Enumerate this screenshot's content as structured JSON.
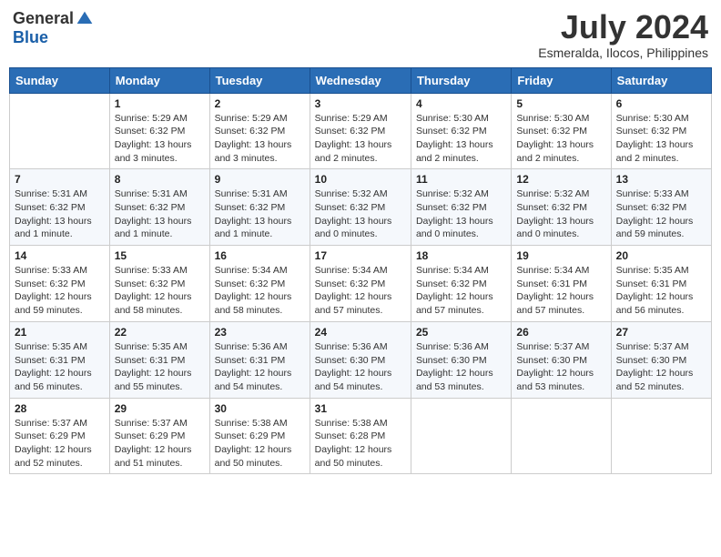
{
  "header": {
    "logo_general": "General",
    "logo_blue": "Blue",
    "month_year": "July 2024",
    "location": "Esmeralda, Ilocos, Philippines"
  },
  "weekdays": [
    "Sunday",
    "Monday",
    "Tuesday",
    "Wednesday",
    "Thursday",
    "Friday",
    "Saturday"
  ],
  "weeks": [
    [
      {
        "day": "",
        "sunrise": "",
        "sunset": "",
        "daylight": ""
      },
      {
        "day": "1",
        "sunrise": "Sunrise: 5:29 AM",
        "sunset": "Sunset: 6:32 PM",
        "daylight": "Daylight: 13 hours and 3 minutes."
      },
      {
        "day": "2",
        "sunrise": "Sunrise: 5:29 AM",
        "sunset": "Sunset: 6:32 PM",
        "daylight": "Daylight: 13 hours and 3 minutes."
      },
      {
        "day": "3",
        "sunrise": "Sunrise: 5:29 AM",
        "sunset": "Sunset: 6:32 PM",
        "daylight": "Daylight: 13 hours and 2 minutes."
      },
      {
        "day": "4",
        "sunrise": "Sunrise: 5:30 AM",
        "sunset": "Sunset: 6:32 PM",
        "daylight": "Daylight: 13 hours and 2 minutes."
      },
      {
        "day": "5",
        "sunrise": "Sunrise: 5:30 AM",
        "sunset": "Sunset: 6:32 PM",
        "daylight": "Daylight: 13 hours and 2 minutes."
      },
      {
        "day": "6",
        "sunrise": "Sunrise: 5:30 AM",
        "sunset": "Sunset: 6:32 PM",
        "daylight": "Daylight: 13 hours and 2 minutes."
      }
    ],
    [
      {
        "day": "7",
        "sunrise": "Sunrise: 5:31 AM",
        "sunset": "Sunset: 6:32 PM",
        "daylight": "Daylight: 13 hours and 1 minute."
      },
      {
        "day": "8",
        "sunrise": "Sunrise: 5:31 AM",
        "sunset": "Sunset: 6:32 PM",
        "daylight": "Daylight: 13 hours and 1 minute."
      },
      {
        "day": "9",
        "sunrise": "Sunrise: 5:31 AM",
        "sunset": "Sunset: 6:32 PM",
        "daylight": "Daylight: 13 hours and 1 minute."
      },
      {
        "day": "10",
        "sunrise": "Sunrise: 5:32 AM",
        "sunset": "Sunset: 6:32 PM",
        "daylight": "Daylight: 13 hours and 0 minutes."
      },
      {
        "day": "11",
        "sunrise": "Sunrise: 5:32 AM",
        "sunset": "Sunset: 6:32 PM",
        "daylight": "Daylight: 13 hours and 0 minutes."
      },
      {
        "day": "12",
        "sunrise": "Sunrise: 5:32 AM",
        "sunset": "Sunset: 6:32 PM",
        "daylight": "Daylight: 13 hours and 0 minutes."
      },
      {
        "day": "13",
        "sunrise": "Sunrise: 5:33 AM",
        "sunset": "Sunset: 6:32 PM",
        "daylight": "Daylight: 12 hours and 59 minutes."
      }
    ],
    [
      {
        "day": "14",
        "sunrise": "Sunrise: 5:33 AM",
        "sunset": "Sunset: 6:32 PM",
        "daylight": "Daylight: 12 hours and 59 minutes."
      },
      {
        "day": "15",
        "sunrise": "Sunrise: 5:33 AM",
        "sunset": "Sunset: 6:32 PM",
        "daylight": "Daylight: 12 hours and 58 minutes."
      },
      {
        "day": "16",
        "sunrise": "Sunrise: 5:34 AM",
        "sunset": "Sunset: 6:32 PM",
        "daylight": "Daylight: 12 hours and 58 minutes."
      },
      {
        "day": "17",
        "sunrise": "Sunrise: 5:34 AM",
        "sunset": "Sunset: 6:32 PM",
        "daylight": "Daylight: 12 hours and 57 minutes."
      },
      {
        "day": "18",
        "sunrise": "Sunrise: 5:34 AM",
        "sunset": "Sunset: 6:32 PM",
        "daylight": "Daylight: 12 hours and 57 minutes."
      },
      {
        "day": "19",
        "sunrise": "Sunrise: 5:34 AM",
        "sunset": "Sunset: 6:31 PM",
        "daylight": "Daylight: 12 hours and 57 minutes."
      },
      {
        "day": "20",
        "sunrise": "Sunrise: 5:35 AM",
        "sunset": "Sunset: 6:31 PM",
        "daylight": "Daylight: 12 hours and 56 minutes."
      }
    ],
    [
      {
        "day": "21",
        "sunrise": "Sunrise: 5:35 AM",
        "sunset": "Sunset: 6:31 PM",
        "daylight": "Daylight: 12 hours and 56 minutes."
      },
      {
        "day": "22",
        "sunrise": "Sunrise: 5:35 AM",
        "sunset": "Sunset: 6:31 PM",
        "daylight": "Daylight: 12 hours and 55 minutes."
      },
      {
        "day": "23",
        "sunrise": "Sunrise: 5:36 AM",
        "sunset": "Sunset: 6:31 PM",
        "daylight": "Daylight: 12 hours and 54 minutes."
      },
      {
        "day": "24",
        "sunrise": "Sunrise: 5:36 AM",
        "sunset": "Sunset: 6:30 PM",
        "daylight": "Daylight: 12 hours and 54 minutes."
      },
      {
        "day": "25",
        "sunrise": "Sunrise: 5:36 AM",
        "sunset": "Sunset: 6:30 PM",
        "daylight": "Daylight: 12 hours and 53 minutes."
      },
      {
        "day": "26",
        "sunrise": "Sunrise: 5:37 AM",
        "sunset": "Sunset: 6:30 PM",
        "daylight": "Daylight: 12 hours and 53 minutes."
      },
      {
        "day": "27",
        "sunrise": "Sunrise: 5:37 AM",
        "sunset": "Sunset: 6:30 PM",
        "daylight": "Daylight: 12 hours and 52 minutes."
      }
    ],
    [
      {
        "day": "28",
        "sunrise": "Sunrise: 5:37 AM",
        "sunset": "Sunset: 6:29 PM",
        "daylight": "Daylight: 12 hours and 52 minutes."
      },
      {
        "day": "29",
        "sunrise": "Sunrise: 5:37 AM",
        "sunset": "Sunset: 6:29 PM",
        "daylight": "Daylight: 12 hours and 51 minutes."
      },
      {
        "day": "30",
        "sunrise": "Sunrise: 5:38 AM",
        "sunset": "Sunset: 6:29 PM",
        "daylight": "Daylight: 12 hours and 50 minutes."
      },
      {
        "day": "31",
        "sunrise": "Sunrise: 5:38 AM",
        "sunset": "Sunset: 6:28 PM",
        "daylight": "Daylight: 12 hours and 50 minutes."
      },
      {
        "day": "",
        "sunrise": "",
        "sunset": "",
        "daylight": ""
      },
      {
        "day": "",
        "sunrise": "",
        "sunset": "",
        "daylight": ""
      },
      {
        "day": "",
        "sunrise": "",
        "sunset": "",
        "daylight": ""
      }
    ]
  ]
}
